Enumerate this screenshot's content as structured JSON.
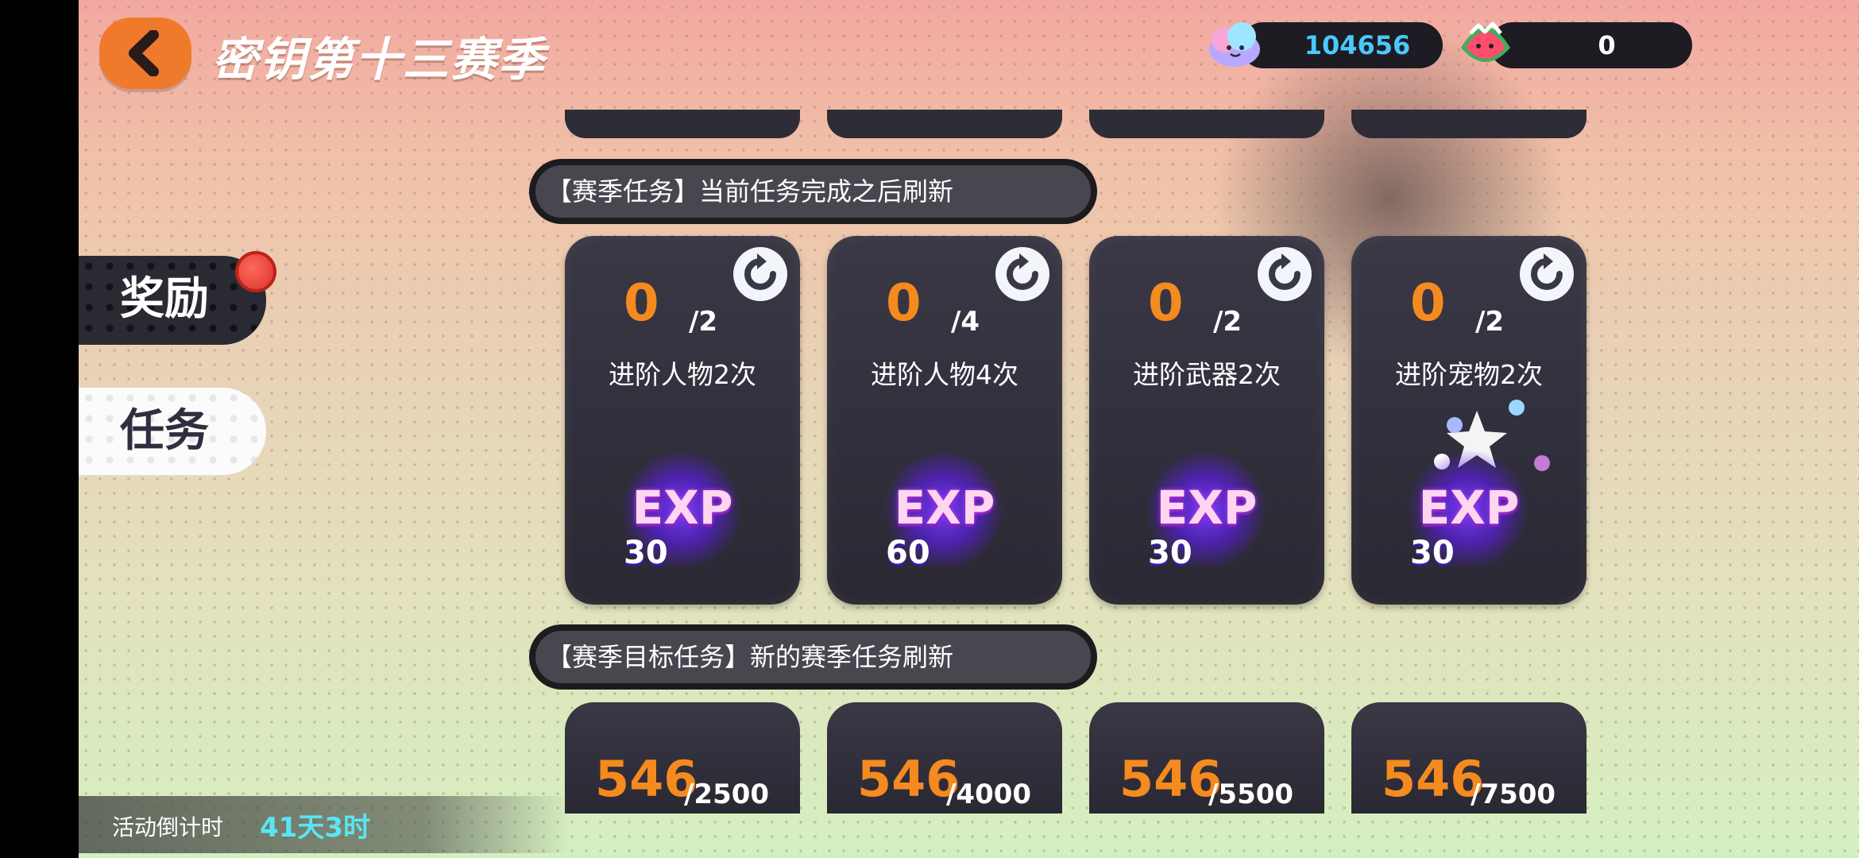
{
  "header": {
    "title": "密钥第十三赛季",
    "currency_a": {
      "icon": "cloud-coin-icon",
      "value": "104656",
      "color": "#4bc8ff"
    },
    "currency_b": {
      "icon": "watermelon-icon",
      "value": "0",
      "color": "#ffffff"
    }
  },
  "tabs": [
    {
      "label": "奖励",
      "active": false
    },
    {
      "label": "任务",
      "active": true
    }
  ],
  "section_current": {
    "label": "【赛季任务】当前任务完成之后刷新",
    "tasks": [
      {
        "current": "0",
        "total": "/2",
        "name": "进阶人物2次",
        "reward_label": "EXP",
        "reward_amount": "30"
      },
      {
        "current": "0",
        "total": "/4",
        "name": "进阶人物4次",
        "reward_label": "EXP",
        "reward_amount": "60"
      },
      {
        "current": "0",
        "total": "/2",
        "name": "进阶武器2次",
        "reward_label": "EXP",
        "reward_amount": "30"
      },
      {
        "current": "0",
        "total": "/2",
        "name": "进阶宠物2次",
        "reward_label": "EXP",
        "reward_amount": "30"
      }
    ]
  },
  "section_goal": {
    "label": "【赛季目标任务】新的赛季任务刷新",
    "tasks": [
      {
        "current": "546",
        "total": "/2500"
      },
      {
        "current": "546",
        "total": "/4000"
      },
      {
        "current": "546",
        "total": "/5500"
      },
      {
        "current": "546",
        "total": "/7500"
      }
    ]
  },
  "countdown": {
    "label": "活动倒计时",
    "value": "41天3时"
  },
  "colors": {
    "accent_orange": "#f58a1f",
    "exp_purple": "#7a1fb0",
    "countdown_cyan": "#58e6f4"
  }
}
